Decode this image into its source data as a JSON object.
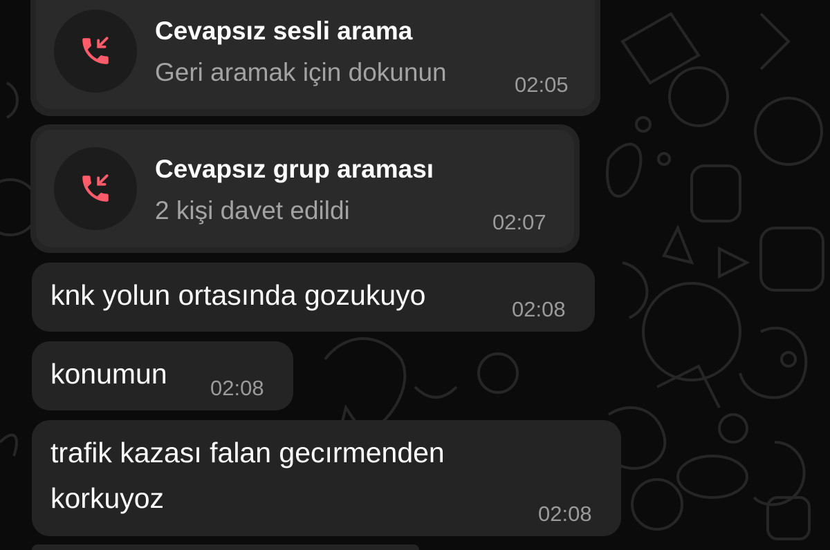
{
  "theme": {
    "accent": "#ff5c6b",
    "bubble": "#242424",
    "background": "#0b0b0b"
  },
  "calls": [
    {
      "title": "Cevapsız sesli arama",
      "subtitle": "Geri aramak için dokunun",
      "time": "02:05",
      "icon": "missed-call-icon"
    },
    {
      "title": "Cevapsız grup araması",
      "subtitle": "2 kişi davet edildi",
      "time": "02:07",
      "icon": "missed-call-icon"
    }
  ],
  "messages": [
    {
      "lines": [
        "knk yolun ortasında gozukuyo"
      ],
      "time": "02:08"
    },
    {
      "lines": [
        "konumun"
      ],
      "time": "02:08"
    },
    {
      "lines": [
        "trafik kazası falan gecırmenden",
        "korkuyoz"
      ],
      "time": "02:08"
    }
  ]
}
